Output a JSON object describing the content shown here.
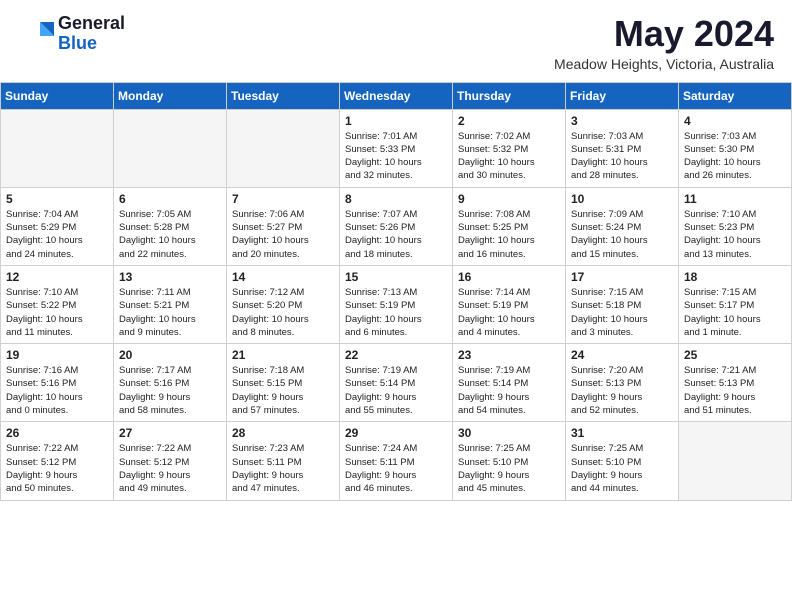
{
  "header": {
    "logo_general": "General",
    "logo_blue": "Blue",
    "month_year": "May 2024",
    "location": "Meadow Heights, Victoria, Australia"
  },
  "days_of_week": [
    "Sunday",
    "Monday",
    "Tuesday",
    "Wednesday",
    "Thursday",
    "Friday",
    "Saturday"
  ],
  "weeks": [
    [
      {
        "day": "",
        "info": ""
      },
      {
        "day": "",
        "info": ""
      },
      {
        "day": "",
        "info": ""
      },
      {
        "day": "1",
        "info": "Sunrise: 7:01 AM\nSunset: 5:33 PM\nDaylight: 10 hours\nand 32 minutes."
      },
      {
        "day": "2",
        "info": "Sunrise: 7:02 AM\nSunset: 5:32 PM\nDaylight: 10 hours\nand 30 minutes."
      },
      {
        "day": "3",
        "info": "Sunrise: 7:03 AM\nSunset: 5:31 PM\nDaylight: 10 hours\nand 28 minutes."
      },
      {
        "day": "4",
        "info": "Sunrise: 7:03 AM\nSunset: 5:30 PM\nDaylight: 10 hours\nand 26 minutes."
      }
    ],
    [
      {
        "day": "5",
        "info": "Sunrise: 7:04 AM\nSunset: 5:29 PM\nDaylight: 10 hours\nand 24 minutes."
      },
      {
        "day": "6",
        "info": "Sunrise: 7:05 AM\nSunset: 5:28 PM\nDaylight: 10 hours\nand 22 minutes."
      },
      {
        "day": "7",
        "info": "Sunrise: 7:06 AM\nSunset: 5:27 PM\nDaylight: 10 hours\nand 20 minutes."
      },
      {
        "day": "8",
        "info": "Sunrise: 7:07 AM\nSunset: 5:26 PM\nDaylight: 10 hours\nand 18 minutes."
      },
      {
        "day": "9",
        "info": "Sunrise: 7:08 AM\nSunset: 5:25 PM\nDaylight: 10 hours\nand 16 minutes."
      },
      {
        "day": "10",
        "info": "Sunrise: 7:09 AM\nSunset: 5:24 PM\nDaylight: 10 hours\nand 15 minutes."
      },
      {
        "day": "11",
        "info": "Sunrise: 7:10 AM\nSunset: 5:23 PM\nDaylight: 10 hours\nand 13 minutes."
      }
    ],
    [
      {
        "day": "12",
        "info": "Sunrise: 7:10 AM\nSunset: 5:22 PM\nDaylight: 10 hours\nand 11 minutes."
      },
      {
        "day": "13",
        "info": "Sunrise: 7:11 AM\nSunset: 5:21 PM\nDaylight: 10 hours\nand 9 minutes."
      },
      {
        "day": "14",
        "info": "Sunrise: 7:12 AM\nSunset: 5:20 PM\nDaylight: 10 hours\nand 8 minutes."
      },
      {
        "day": "15",
        "info": "Sunrise: 7:13 AM\nSunset: 5:19 PM\nDaylight: 10 hours\nand 6 minutes."
      },
      {
        "day": "16",
        "info": "Sunrise: 7:14 AM\nSunset: 5:19 PM\nDaylight: 10 hours\nand 4 minutes."
      },
      {
        "day": "17",
        "info": "Sunrise: 7:15 AM\nSunset: 5:18 PM\nDaylight: 10 hours\nand 3 minutes."
      },
      {
        "day": "18",
        "info": "Sunrise: 7:15 AM\nSunset: 5:17 PM\nDaylight: 10 hours\nand 1 minute."
      }
    ],
    [
      {
        "day": "19",
        "info": "Sunrise: 7:16 AM\nSunset: 5:16 PM\nDaylight: 10 hours\nand 0 minutes."
      },
      {
        "day": "20",
        "info": "Sunrise: 7:17 AM\nSunset: 5:16 PM\nDaylight: 9 hours\nand 58 minutes."
      },
      {
        "day": "21",
        "info": "Sunrise: 7:18 AM\nSunset: 5:15 PM\nDaylight: 9 hours\nand 57 minutes."
      },
      {
        "day": "22",
        "info": "Sunrise: 7:19 AM\nSunset: 5:14 PM\nDaylight: 9 hours\nand 55 minutes."
      },
      {
        "day": "23",
        "info": "Sunrise: 7:19 AM\nSunset: 5:14 PM\nDaylight: 9 hours\nand 54 minutes."
      },
      {
        "day": "24",
        "info": "Sunrise: 7:20 AM\nSunset: 5:13 PM\nDaylight: 9 hours\nand 52 minutes."
      },
      {
        "day": "25",
        "info": "Sunrise: 7:21 AM\nSunset: 5:13 PM\nDaylight: 9 hours\nand 51 minutes."
      }
    ],
    [
      {
        "day": "26",
        "info": "Sunrise: 7:22 AM\nSunset: 5:12 PM\nDaylight: 9 hours\nand 50 minutes."
      },
      {
        "day": "27",
        "info": "Sunrise: 7:22 AM\nSunset: 5:12 PM\nDaylight: 9 hours\nand 49 minutes."
      },
      {
        "day": "28",
        "info": "Sunrise: 7:23 AM\nSunset: 5:11 PM\nDaylight: 9 hours\nand 47 minutes."
      },
      {
        "day": "29",
        "info": "Sunrise: 7:24 AM\nSunset: 5:11 PM\nDaylight: 9 hours\nand 46 minutes."
      },
      {
        "day": "30",
        "info": "Sunrise: 7:25 AM\nSunset: 5:10 PM\nDaylight: 9 hours\nand 45 minutes."
      },
      {
        "day": "31",
        "info": "Sunrise: 7:25 AM\nSunset: 5:10 PM\nDaylight: 9 hours\nand 44 minutes."
      },
      {
        "day": "",
        "info": ""
      }
    ]
  ]
}
